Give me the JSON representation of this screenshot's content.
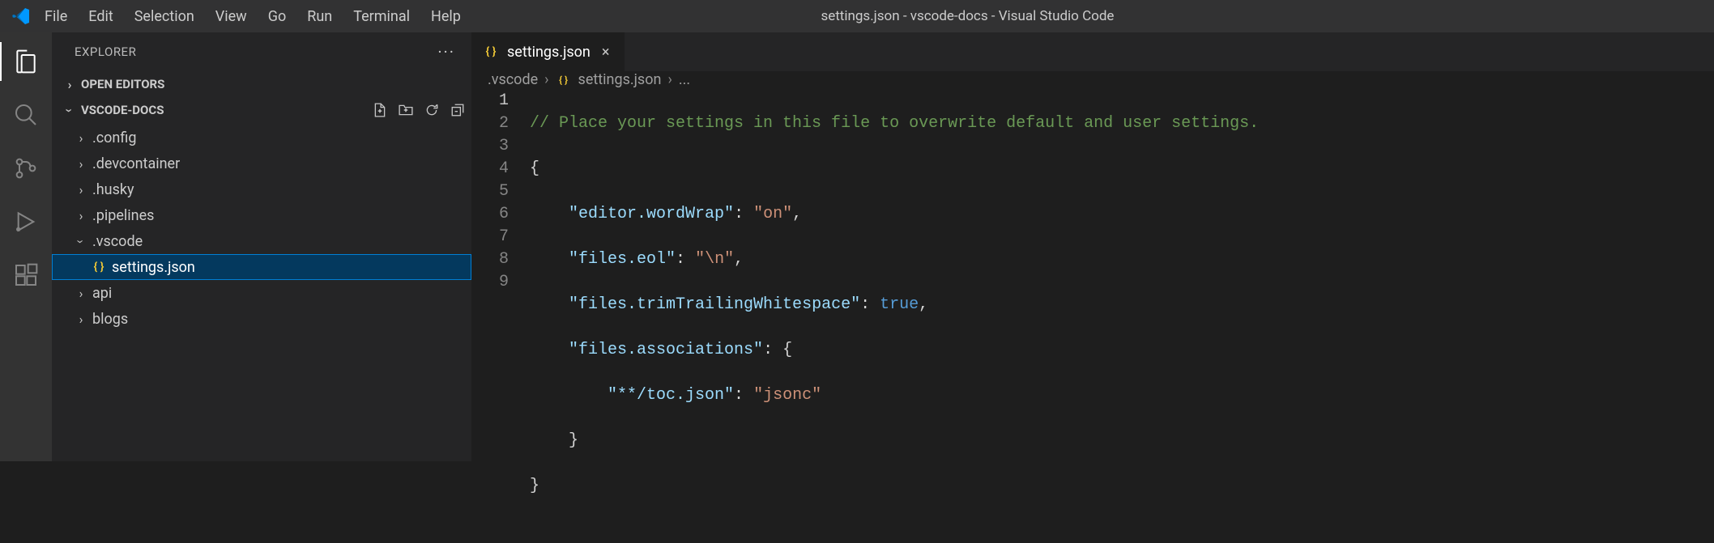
{
  "window_title": "settings.json - vscode-docs - Visual Studio Code",
  "menu": [
    "File",
    "Edit",
    "Selection",
    "View",
    "Go",
    "Run",
    "Terminal",
    "Help"
  ],
  "sidebar": {
    "title": "EXPLORER",
    "open_editors_label": "OPEN EDITORS",
    "workspace_label": "VSCODE-DOCS",
    "items": [
      {
        "label": ".config",
        "kind": "folder",
        "expanded": false
      },
      {
        "label": ".devcontainer",
        "kind": "folder",
        "expanded": false
      },
      {
        "label": ".husky",
        "kind": "folder",
        "expanded": false
      },
      {
        "label": ".pipelines",
        "kind": "folder",
        "expanded": false
      },
      {
        "label": ".vscode",
        "kind": "folder",
        "expanded": true
      },
      {
        "label": "settings.json",
        "kind": "file",
        "selected": true
      },
      {
        "label": "api",
        "kind": "folder",
        "expanded": false
      },
      {
        "label": "blogs",
        "kind": "folder",
        "expanded": false
      }
    ]
  },
  "tab": {
    "label": "settings.json"
  },
  "breadcrumb": {
    "folder": ".vscode",
    "file": "settings.json",
    "trail": "..."
  },
  "code": {
    "lines": [
      "1",
      "2",
      "3",
      "4",
      "5",
      "6",
      "7",
      "8",
      "9"
    ],
    "comment": "// Place your settings in this file to overwrite default and user settings.",
    "l2": "{",
    "k3": "\"editor.wordWrap\"",
    "v3": "\"on\"",
    "k4": "\"files.eol\"",
    "v4": "\"\\n\"",
    "k5": "\"files.trimTrailingWhitespace\"",
    "v5": "true",
    "k6": "\"files.associations\"",
    "v6": "{",
    "k7": "\"**/toc.json\"",
    "v7": "\"jsonc\"",
    "l8": "    }",
    "l9": "}"
  }
}
